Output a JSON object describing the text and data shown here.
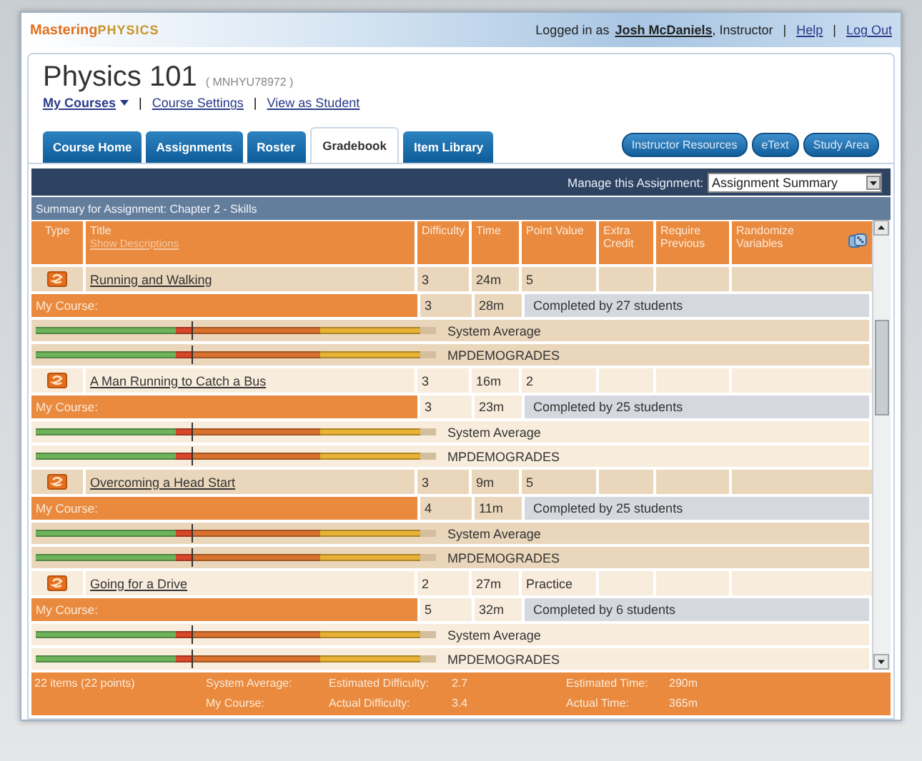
{
  "top_bar": {
    "logo": {
      "part_1": "Mastering",
      "part_2": "PHYSICS"
    },
    "login_prefix": "Logged in as",
    "user": "Josh McDaniels",
    "role": ", Instructor",
    "links": [
      "Help",
      "Log Out"
    ],
    "separator": "|"
  },
  "course": {
    "title": "Physics 101",
    "code": "( MNHYU78972 )",
    "links": [
      "My Courses",
      "Course Settings",
      "View as Student"
    ],
    "separator": "|"
  },
  "tabs": [
    {
      "label": "Course Home",
      "selected": false
    },
    {
      "label": "Assignments",
      "selected": false
    },
    {
      "label": "Roster",
      "selected": false
    },
    {
      "label": "Gradebook",
      "selected": true
    },
    {
      "label": "Item Library",
      "selected": false
    }
  ],
  "resource_buttons": [
    "Instructor Resources",
    "eText",
    "Study Area"
  ],
  "manage": {
    "label": "Manage this Assignment:",
    "value": "Assignment Summary"
  },
  "summary_title": "Summary for Assignment: Chapter 2 - Skills",
  "columns": [
    {
      "label": "Type"
    },
    {
      "label": "Title",
      "link": "Show Descriptions"
    },
    {
      "label": "Difficulty"
    },
    {
      "label": "Time"
    },
    {
      "label": "Point Value"
    },
    {
      "label": "Extra Credit"
    },
    {
      "label": "Require Previous"
    },
    {
      "label": "Randomize Variables"
    }
  ],
  "rows": [
    {
      "title": "Running and Walking",
      "difficulty": "3",
      "time": "24m",
      "point_value": "5",
      "my_course": {
        "label": "My Course:",
        "difficulty": "3",
        "time": "28m",
        "completed": "Completed by 27 students"
      },
      "bars": [
        {
          "label": "System Average",
          "marker": {
            "level": 0.39
          },
          "segments": [
            {
              "color": "#6db35a"
            },
            {
              "color": "#d9472b"
            },
            {
              "color": "#d8722e"
            },
            {
              "color": "#e8b234"
            }
          ]
        },
        {
          "label": "MPDEMOGRADES",
          "marker": {
            "level": 0.39
          },
          "segments": [
            {
              "color": "#6db35a"
            },
            {
              "color": "#d9472b"
            },
            {
              "color": "#d8722e"
            },
            {
              "color": "#e8b234"
            }
          ]
        }
      ]
    },
    {
      "title": "A Man Running to Catch a Bus",
      "difficulty": "3",
      "time": "16m",
      "point_value": "2",
      "my_course": {
        "label": "My Course:",
        "difficulty": "3",
        "time": "23m",
        "completed": "Completed by 25 students"
      },
      "bars": [
        {
          "label": "System Average",
          "marker": {
            "level": 0.39
          },
          "segments": [
            {
              "color": "#6db35a"
            },
            {
              "color": "#d9472b"
            },
            {
              "color": "#d8722e"
            },
            {
              "color": "#e8b234"
            }
          ]
        },
        {
          "label": "MPDEMOGRADES",
          "marker": {
            "level": 0.39
          },
          "segments": [
            {
              "color": "#6db35a"
            },
            {
              "color": "#d9472b"
            },
            {
              "color": "#d8722e"
            },
            {
              "color": "#e8b234"
            }
          ]
        }
      ]
    },
    {
      "title": "Overcoming a Head Start",
      "difficulty": "3",
      "time": "9m",
      "point_value": "5",
      "my_course": {
        "label": "My Course:",
        "difficulty": "4",
        "time": "11m",
        "completed": "Completed by 25 students"
      },
      "bars": [
        {
          "label": "System Average",
          "marker": {
            "level": 0.39
          },
          "segments": [
            {
              "color": "#6db35a"
            },
            {
              "color": "#d9472b"
            },
            {
              "color": "#d8722e"
            },
            {
              "color": "#e8b234"
            }
          ]
        },
        {
          "label": "MPDEMOGRADES",
          "marker": {
            "level": 0.39
          },
          "segments": [
            {
              "color": "#6db35a"
            },
            {
              "color": "#d9472b"
            },
            {
              "color": "#d8722e"
            },
            {
              "color": "#e8b234"
            }
          ]
        }
      ]
    },
    {
      "title": "Going for a Drive",
      "difficulty": "2",
      "time": "27m",
      "point_value": "Practice",
      "my_course": {
        "label": "My Course:",
        "difficulty": "5",
        "time": "32m",
        "completed": "Completed by 6 students"
      },
      "bars": [
        {
          "label": "System Average",
          "marker": {
            "level": 0.39
          },
          "segments": [
            {
              "color": "#6db35a"
            },
            {
              "color": "#d9472b"
            },
            {
              "color": "#d8722e"
            },
            {
              "color": "#e8b234"
            }
          ]
        },
        {
          "label": "MPDEMOGRADES",
          "marker": {
            "level": 0.39
          },
          "segments": [
            {
              "color": "#6db35a"
            },
            {
              "color": "#d9472b"
            },
            {
              "color": "#d8722e"
            },
            {
              "color": "#e8b234"
            }
          ]
        }
      ]
    }
  ],
  "footer": {
    "rows": [
      [
        "22 items (22 points)",
        "System Average:",
        "Estimated Difficulty:",
        "2.7",
        "Estimated Time:",
        "290m"
      ],
      [
        "",
        "My Course:",
        "Actual Difficulty:",
        "3.4",
        "Actual Time:",
        "365m"
      ]
    ]
  }
}
